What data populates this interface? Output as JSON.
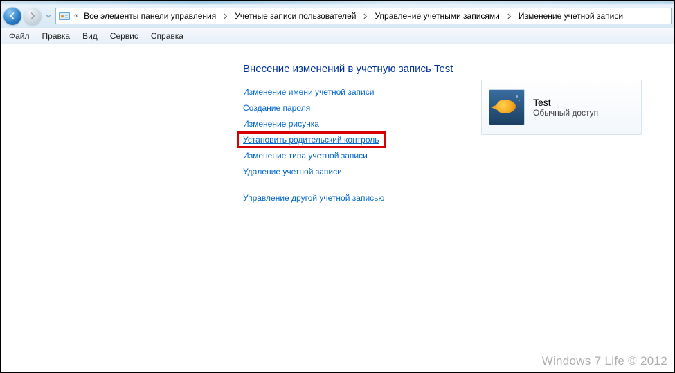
{
  "breadcrumbs": {
    "items": [
      "Все элементы панели управления",
      "Учетные записи пользователей",
      "Управление учетными записями",
      "Изменение учетной записи"
    ]
  },
  "menu": {
    "file": "Файл",
    "edit": "Правка",
    "view": "Вид",
    "tools": "Сервис",
    "help": "Справка"
  },
  "page": {
    "heading": "Внесение изменений в учетную запись Test",
    "links": {
      "rename": "Изменение имени учетной записи",
      "create_password": "Создание пароля",
      "change_picture": "Изменение рисунка",
      "parental": "Установить родительский контроль",
      "change_type": "Изменение типа учетной записи",
      "delete": "Удаление учетной записи",
      "manage_other": "Управление другой учетной записью"
    }
  },
  "user": {
    "name": "Test",
    "role": "Обычный доступ"
  },
  "watermark": "Windows 7 Life © 2012"
}
